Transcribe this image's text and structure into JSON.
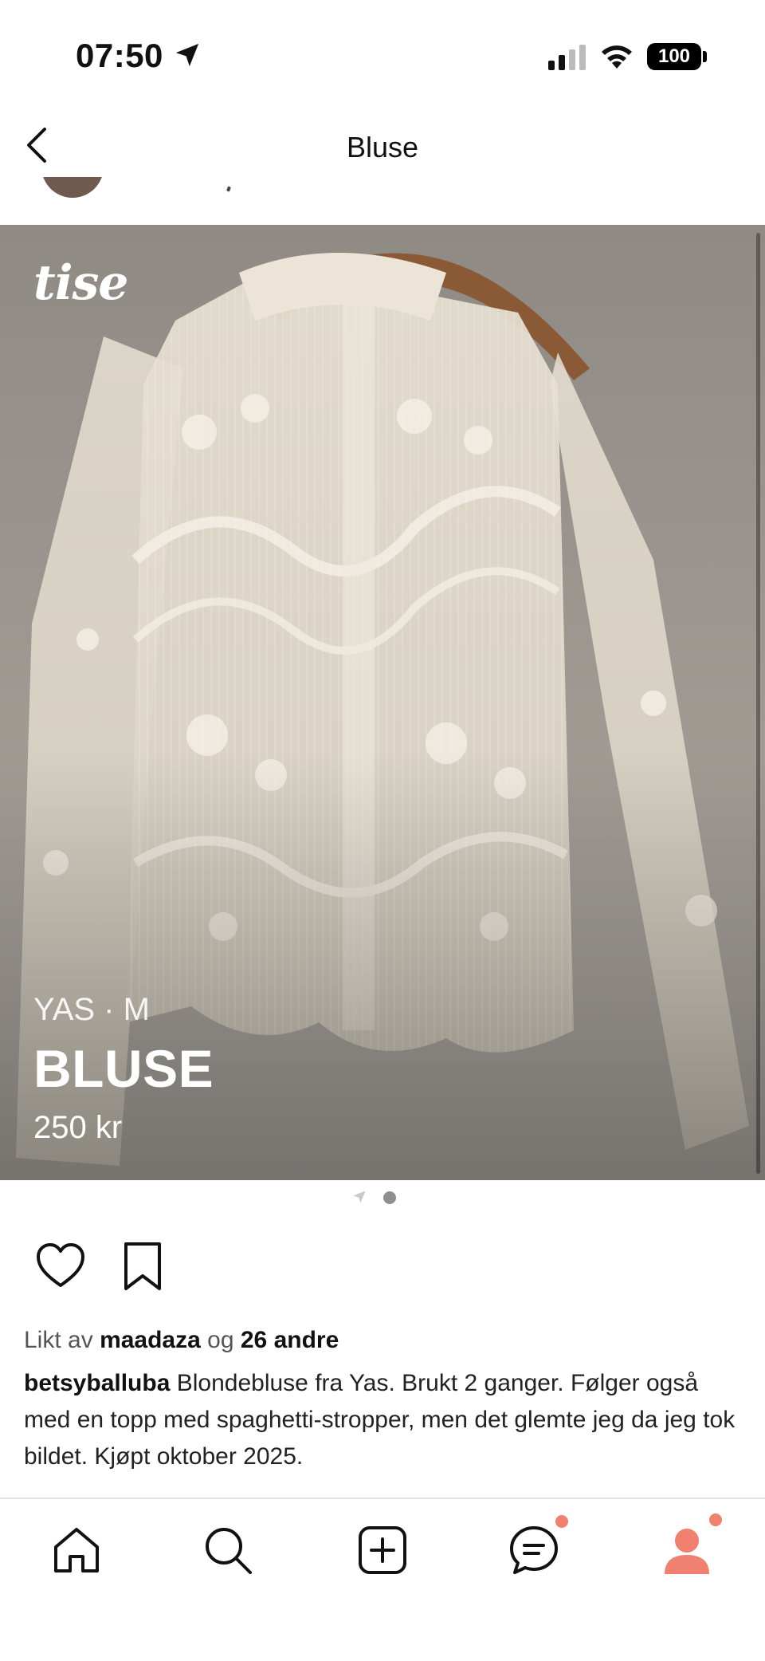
{
  "status_bar": {
    "time": "07:50",
    "battery": "100",
    "icons": [
      "location-arrow-icon",
      "signal-icon",
      "wifi-icon",
      "battery-icon"
    ]
  },
  "header": {
    "title": "Bluse",
    "back_icon": "chevron-left-icon"
  },
  "listing": {
    "brand_size": "YAS · M",
    "title": "BLUSE",
    "price": "250 kr",
    "watermark": "tise"
  },
  "pager": {
    "active_index": 1,
    "count": 2
  },
  "actions": {
    "like_icon": "heart-icon",
    "save_icon": "bookmark-icon"
  },
  "likes": {
    "prefix": "Likt av",
    "user": "maadaza",
    "conj": "og",
    "others": "26 andre"
  },
  "caption": {
    "user": "betsyballuba",
    "text": "Blondebluse fra Yas. Brukt 2 ganger. Følger også med en topp med spaghetti-stropper, men det glemte jeg da jeg tok bildet.  Kjøpt oktober 2025."
  },
  "tab_bar": {
    "items": [
      "home-icon",
      "search-icon",
      "add-icon",
      "messages-icon",
      "profile-icon"
    ],
    "badges": [
      "messages",
      "profile"
    ]
  },
  "colors": {
    "accent": "#f08070",
    "text": "#111111",
    "muted": "#555555"
  }
}
